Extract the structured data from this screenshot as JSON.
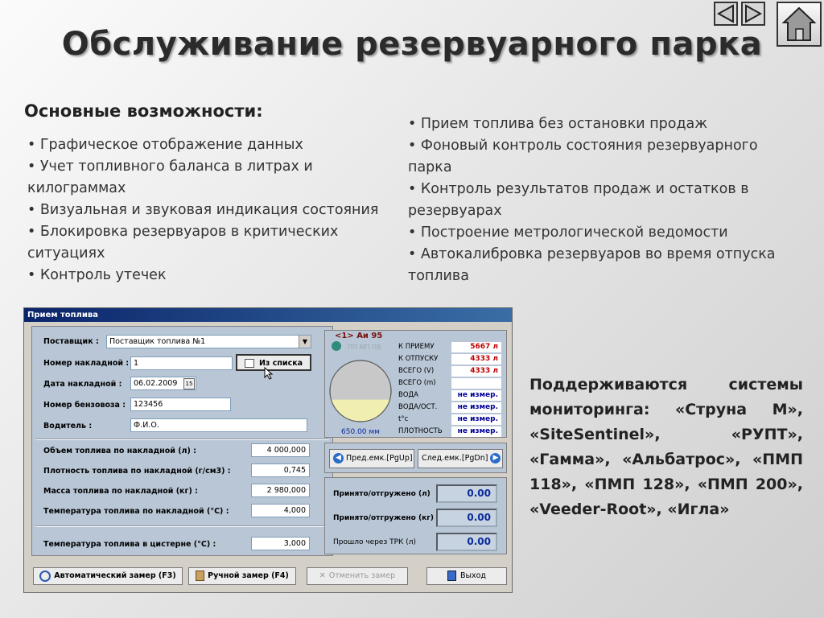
{
  "slide": {
    "title": "Обслуживание резервуарного парка",
    "features_heading": "Основные возможности:",
    "left_bullets": [
      "• Графическое отображение данных",
      "• Учет топливного баланса в литрах и килограммах",
      "• Визуальная и звуковая индикация состояния",
      "• Блокировка резервуаров в критических ситуациях",
      "• Контроль утечек"
    ],
    "right_bullets": [
      "• Прием топлива без остановки продаж",
      "• Фоновый контроль состояния резервуарного парка",
      "• Контроль результатов продаж и остатков в резервуарах",
      "• Построение метрологической ведомости",
      "• Автокалибровка резервуаров во время отпуска топлива"
    ],
    "monitoring_text": "Поддерживаются системы мониторинга: «Струна М», «SiteSentinel», «РУПТ», «Гамма», «Альбатрос», «ПМП 118», «ПМП 128», «ПМП 200», «Veeder-Root», «Игла»",
    "nav": {
      "prev_icon": "triangle-left-icon",
      "next_icon": "triangle-right-icon",
      "home_icon": "home-icon"
    }
  },
  "dialog": {
    "title": "Прием топлива",
    "supplier_label": "Поставщик :",
    "supplier_value": "Поставщик топлива №1",
    "invoice_no_label": "Номер накладной :",
    "invoice_no_value": "1",
    "from_list_button": "Из списка",
    "invoice_date_label": "Дата накладной :",
    "invoice_date_value": "06.02.2009",
    "calendar_glyph": "15",
    "truck_no_label": "Номер бензовоза :",
    "truck_no_value": "123456",
    "driver_label": "Водитель :",
    "driver_value": "Ф.И.О.",
    "volume_label": "Объем топлива по накладной (л) :",
    "volume_value": "4 000,000",
    "density_label": "Плотность  топлива по накладной (г/см3) :",
    "density_value": "0,745",
    "mass_label": "Масса топлива по накладной (кг) :",
    "mass_value": "2 980,000",
    "temp_label": "Температура топлива по накладной (°C) :",
    "temp_value": "4,000",
    "tank_temp_label": "Температура топлива в цистерне (°C) :",
    "tank_temp_value": "3,000",
    "tank": {
      "title": "<1> Аи 95",
      "sensor_label": "ПП МП ПВ",
      "capacity_text": "650.00 мм",
      "fill_fraction": 0.36,
      "fill_color": "#f0eeb0",
      "empty_color": "#c8c8c8",
      "indicator_color": "#2f8c7c",
      "rows": [
        {
          "label": "К ПРИЕМУ",
          "value": "5667 л",
          "style": "red"
        },
        {
          "label": "К ОТПУСКУ",
          "value": "4333 л",
          "style": "red"
        },
        {
          "label": "ВСЕГО (V)",
          "value": "4333 л",
          "style": "red"
        },
        {
          "label": "ВСЕГО (m)",
          "value": "",
          "style": "red"
        },
        {
          "label": "ВОДА",
          "value": "не измер.",
          "style": "blue"
        },
        {
          "label": "ВОДА/ОСТ.",
          "value": "не измер.",
          "style": "blue"
        },
        {
          "label": "t°c",
          "value": "не измер.",
          "style": "blue"
        },
        {
          "label": "ПЛОТНОСТЬ",
          "value": "не измер.",
          "style": "blue"
        }
      ]
    },
    "prev_tank_button": "Пред.емк.[PgUp]",
    "next_tank_button": "След.емк.[PgDn]",
    "totals": [
      {
        "label": "Принято/отгружено (л)",
        "value": "0.00"
      },
      {
        "label": "Принято/отгружено (кг)",
        "value": "0.00"
      },
      {
        "label": "Прошло через ТРК (л)",
        "value": "0.00"
      }
    ],
    "buttons": {
      "auto_measure": "Автоматический замер  (F3)",
      "manual_measure": "Ручной замер  (F4)",
      "cancel_measure": "Отменить замер",
      "exit": "Выход"
    }
  }
}
